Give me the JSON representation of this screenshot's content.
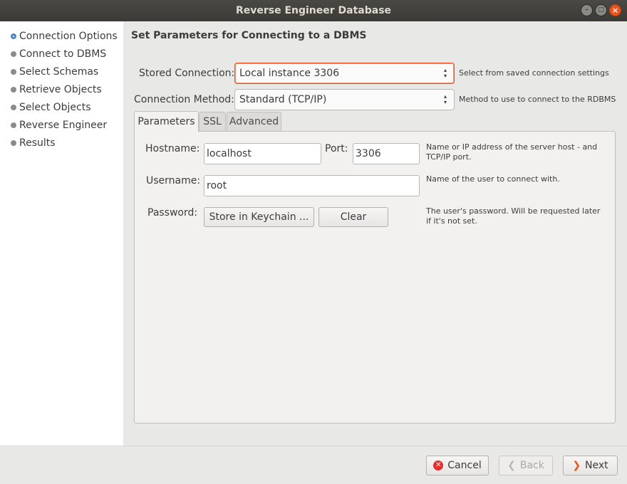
{
  "window": {
    "title": "Reverse Engineer Database"
  },
  "steps": [
    {
      "label": "Connection Options",
      "active": true
    },
    {
      "label": "Connect to DBMS",
      "active": false
    },
    {
      "label": "Select Schemas",
      "active": false
    },
    {
      "label": "Retrieve Objects",
      "active": false
    },
    {
      "label": "Select Objects",
      "active": false
    },
    {
      "label": "Reverse Engineer",
      "active": false
    },
    {
      "label": "Results",
      "active": false
    }
  ],
  "page": {
    "title": "Set Parameters for Connecting to a DBMS",
    "stored_connection": {
      "label": "Stored Connection:",
      "value": "Local instance 3306",
      "hint": "Select from saved connection settings"
    },
    "connection_method": {
      "label": "Connection Method:",
      "value": "Standard (TCP/IP)",
      "hint": "Method to use to connect to the RDBMS"
    },
    "tabs": [
      "Parameters",
      "SSL",
      "Advanced"
    ],
    "parameters": {
      "hostname_label": "Hostname:",
      "hostname_value": "localhost",
      "port_label": "Port:",
      "port_value": "3306",
      "host_hint_1": "Name or IP address of the server host - and",
      "host_hint_2": "TCP/IP port.",
      "username_label": "Username:",
      "username_value": "root",
      "username_hint": "Name of the user to connect with.",
      "password_label": "Password:",
      "store_keychain": "Store in Keychain ...",
      "clear": "Clear",
      "password_hint_1": "The user's password. Will be requested later",
      "password_hint_2": "if it's not set."
    }
  },
  "footer": {
    "cancel": "Cancel",
    "back": "Back",
    "next": "Next"
  },
  "colors": {
    "accent": "#e95420",
    "active_step": "#4a82c4",
    "cancel_icon": "#e0312f"
  }
}
